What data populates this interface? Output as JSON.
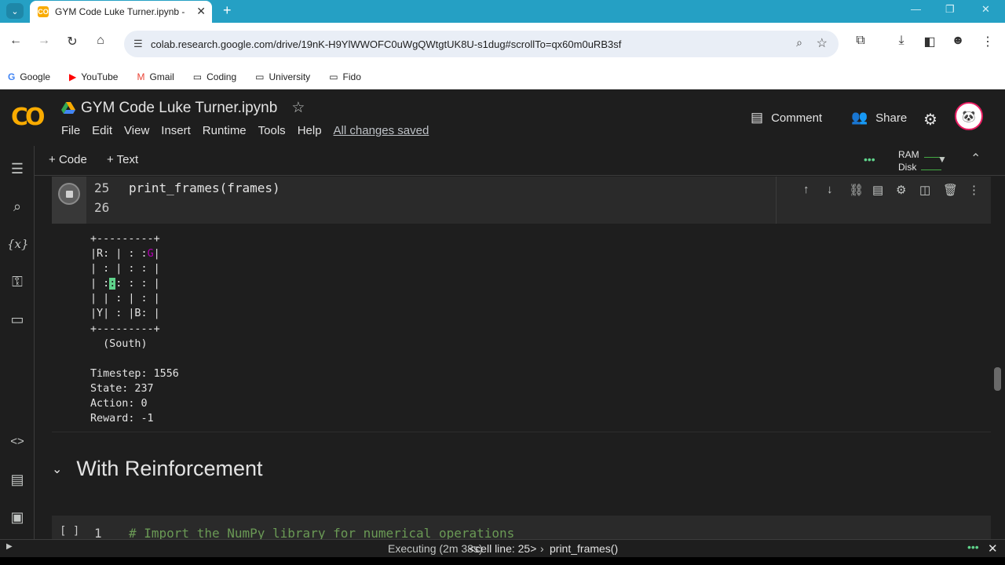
{
  "browser": {
    "tab_title": "GYM Code Luke Turner.ipynb -",
    "url": "colab.research.google.com/drive/19nK-H9YlWWOFC0uWgQWtgtUK8U-s1dug#scrollTo=qx60m0uRB3sf",
    "bookmarks": [
      "Google",
      "YouTube",
      "Gmail",
      "Coding",
      "University",
      "Fido"
    ]
  },
  "notebook": {
    "title": "GYM Code Luke Turner.ipynb",
    "menu": [
      "File",
      "Edit",
      "View",
      "Insert",
      "Runtime",
      "Tools",
      "Help"
    ],
    "save_status": "All changes saved",
    "comment_label": "Comment",
    "share_label": "Share",
    "add_code": "Code",
    "add_text": "Text",
    "ram_label": "RAM",
    "disk_label": "Disk"
  },
  "cell": {
    "line_numbers": [
      "25",
      "26"
    ],
    "code_line": "print_frames(frames)"
  },
  "output": {
    "map_lines": [
      "+---------+",
      "|R: | : :G|",
      "| : | : : |",
      "| : : : : |",
      "| | : | : |",
      "|Y| : |B: |",
      "+---------+"
    ],
    "action_text": "  (South)",
    "timestep": "Timestep: 1556",
    "state": "State: 237",
    "action": "Action: 0",
    "reward": "Reward: -1"
  },
  "section": {
    "title": "With Reinforcement"
  },
  "next_cell": {
    "brackets": "[ ]",
    "line_number": "1",
    "code": "# Import the NumPy library for numerical operations"
  },
  "status": {
    "executing": "Executing (2m 38s)",
    "cell_line": "<cell line: 25>",
    "func": "print_frames()"
  },
  "colors": {
    "tab_bar": "#25a0c4",
    "colab_logo": "#f9ab00",
    "taxi": "#5fd38b",
    "destination": "#b300b3"
  }
}
